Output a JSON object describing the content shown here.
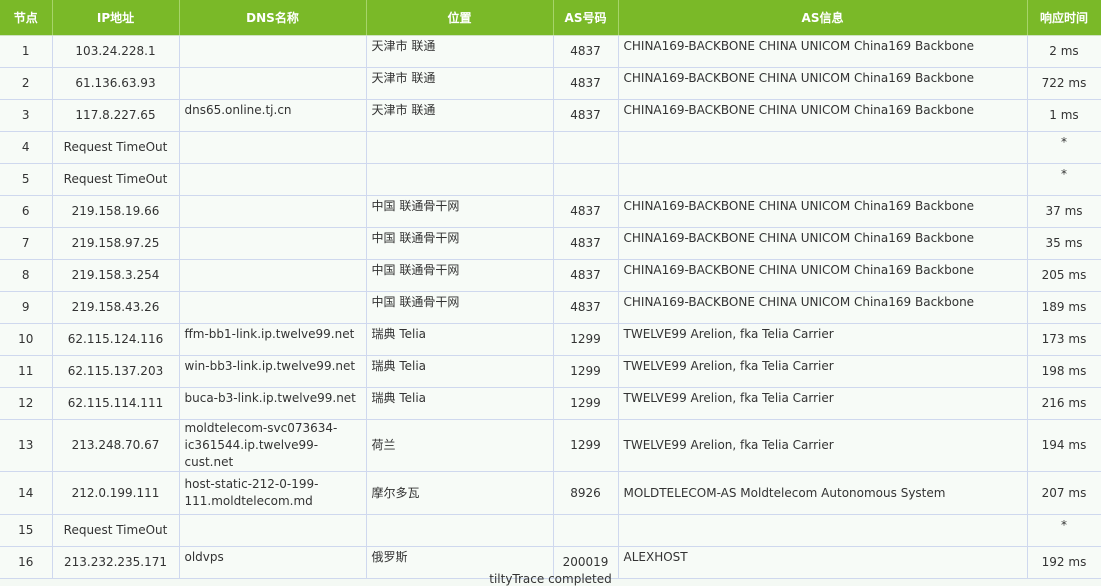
{
  "headers": {
    "node": "节点",
    "ip": "IP地址",
    "dns": "DNS名称",
    "location": "位置",
    "asn": "AS号码",
    "asinfo": "AS信息",
    "rtt": "响应时间"
  },
  "rows": [
    {
      "node": "1",
      "ip": "103.24.228.1",
      "dns": "",
      "location": "天津市 联通",
      "asn": "4837",
      "asinfo": "CHINA169-BACKBONE CHINA UNICOM China169 Backbone",
      "rtt": "2 ms"
    },
    {
      "node": "2",
      "ip": "61.136.63.93",
      "dns": "",
      "location": "天津市 联通",
      "asn": "4837",
      "asinfo": "CHINA169-BACKBONE CHINA UNICOM China169 Backbone",
      "rtt": "722 ms"
    },
    {
      "node": "3",
      "ip": "117.8.227.65",
      "dns": "dns65.online.tj.cn",
      "location": "天津市 联通",
      "asn": "4837",
      "asinfo": "CHINA169-BACKBONE CHINA UNICOM China169 Backbone",
      "rtt": "1 ms"
    },
    {
      "node": "4",
      "ip": "Request TimeOut",
      "dns": "",
      "location": "",
      "asn": "",
      "asinfo": "",
      "rtt": "*"
    },
    {
      "node": "5",
      "ip": "Request TimeOut",
      "dns": "",
      "location": "",
      "asn": "",
      "asinfo": "",
      "rtt": "*"
    },
    {
      "node": "6",
      "ip": "219.158.19.66",
      "dns": "",
      "location": "中国 联通骨干网",
      "asn": "4837",
      "asinfo": "CHINA169-BACKBONE CHINA UNICOM China169 Backbone",
      "rtt": "37 ms"
    },
    {
      "node": "7",
      "ip": "219.158.97.25",
      "dns": "",
      "location": "中国 联通骨干网",
      "asn": "4837",
      "asinfo": "CHINA169-BACKBONE CHINA UNICOM China169 Backbone",
      "rtt": "35 ms"
    },
    {
      "node": "8",
      "ip": "219.158.3.254",
      "dns": "",
      "location": "中国 联通骨干网",
      "asn": "4837",
      "asinfo": "CHINA169-BACKBONE CHINA UNICOM China169 Backbone",
      "rtt": "205 ms"
    },
    {
      "node": "9",
      "ip": "219.158.43.26",
      "dns": "",
      "location": "中国 联通骨干网",
      "asn": "4837",
      "asinfo": "CHINA169-BACKBONE CHINA UNICOM China169 Backbone",
      "rtt": "189 ms"
    },
    {
      "node": "10",
      "ip": "62.115.124.116",
      "dns": "ffm-bb1-link.ip.twelve99.net",
      "location": "瑞典 Telia",
      "asn": "1299",
      "asinfo": "TWELVE99 Arelion, fka Telia Carrier",
      "rtt": "173 ms"
    },
    {
      "node": "11",
      "ip": "62.115.137.203",
      "dns": "win-bb3-link.ip.twelve99.net",
      "location": "瑞典 Telia",
      "asn": "1299",
      "asinfo": "TWELVE99 Arelion, fka Telia Carrier",
      "rtt": "198 ms"
    },
    {
      "node": "12",
      "ip": "62.115.114.111",
      "dns": "buca-b3-link.ip.twelve99.net",
      "location": "瑞典 Telia",
      "asn": "1299",
      "asinfo": "TWELVE99 Arelion, fka Telia Carrier",
      "rtt": "216 ms"
    },
    {
      "node": "13",
      "ip": "213.248.70.67",
      "dns": "moldtelecom-svc073634-ic361544.ip.twelve99-cust.net",
      "location": "荷兰",
      "asn": "1299",
      "asinfo": "TWELVE99 Arelion, fka Telia Carrier",
      "rtt": "194 ms"
    },
    {
      "node": "14",
      "ip": "212.0.199.111",
      "dns": "host-static-212-0-199-111.moldtelecom.md",
      "location": "摩尔多瓦",
      "asn": "8926",
      "asinfo": "MOLDTELECOM-AS Moldtelecom Autonomous System",
      "rtt": "207 ms"
    },
    {
      "node": "15",
      "ip": "Request TimeOut",
      "dns": "",
      "location": "",
      "asn": "",
      "asinfo": "",
      "rtt": "*"
    },
    {
      "node": "16",
      "ip": "213.232.235.171",
      "dns": "oldvps",
      "location": "俄罗斯",
      "asn": "200019",
      "asinfo": "ALEXHOST",
      "rtt": "192 ms"
    }
  ],
  "footer": "tiltyTrace completed"
}
